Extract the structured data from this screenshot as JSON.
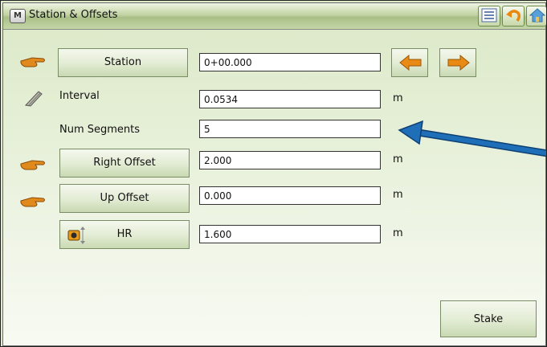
{
  "window": {
    "title": "Station & Offsets",
    "app_icon_glyph": "M",
    "toolbar_icons": [
      "list-icon",
      "undo-icon",
      "home-icon"
    ]
  },
  "rows": {
    "station": {
      "button_label": "Station",
      "value": "0+00.000"
    },
    "interval": {
      "label": "Interval",
      "value": "0.0534",
      "unit": "m"
    },
    "num_segments": {
      "label": "Num Segments",
      "value": "5"
    },
    "right_offset": {
      "button_label": "Right Offset",
      "value": "2.000",
      "unit": "m"
    },
    "up_offset": {
      "button_label": "Up Offset",
      "value": "0.000",
      "unit": "m"
    },
    "hr": {
      "button_label": "HR",
      "value": "1.600",
      "unit": "m"
    }
  },
  "actions": {
    "stake_label": "Stake"
  },
  "colors": {
    "accent_orange": "#e98a14",
    "annotation_arrow": "#1f6fb8",
    "panel_green": "#dbe8c6"
  }
}
